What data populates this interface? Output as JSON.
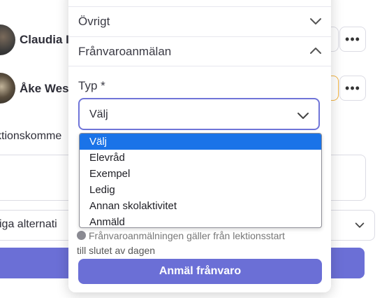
{
  "background": {
    "people": [
      {
        "name": "Claudia I"
      },
      {
        "name": "Åke Wes"
      }
    ],
    "comment_label": "ktionskomme",
    "options_select": {
      "value": "iga alternati"
    }
  },
  "modal": {
    "accordions": [
      {
        "label": "Övrigt",
        "state": "collapsed"
      },
      {
        "label": "Frånvaroanmälan",
        "state": "expanded"
      }
    ],
    "type_field": {
      "label": "Typ *",
      "value": "Välj",
      "options": [
        "Välj",
        "Elevråd",
        "Exempel",
        "Ledig",
        "Annan skolaktivitet",
        "Anmäld"
      ],
      "selected_index": 0
    },
    "hint_line1": "Frånvaroanmälningen gäller från lektionsstart",
    "hint_line2": "till slutet av dagen",
    "submit_label": "Anmäl frånvaro"
  },
  "colors": {
    "primary": "#6b6fd6",
    "focus_border": "#7075d8",
    "selected_option": "#1a73e8",
    "warning_border": "#f2b341"
  },
  "icons": {
    "more": "more-horizontal-icon",
    "chevron_down": "chevron-down-icon",
    "chevron_up": "chevron-up-icon",
    "info": "info-icon"
  }
}
